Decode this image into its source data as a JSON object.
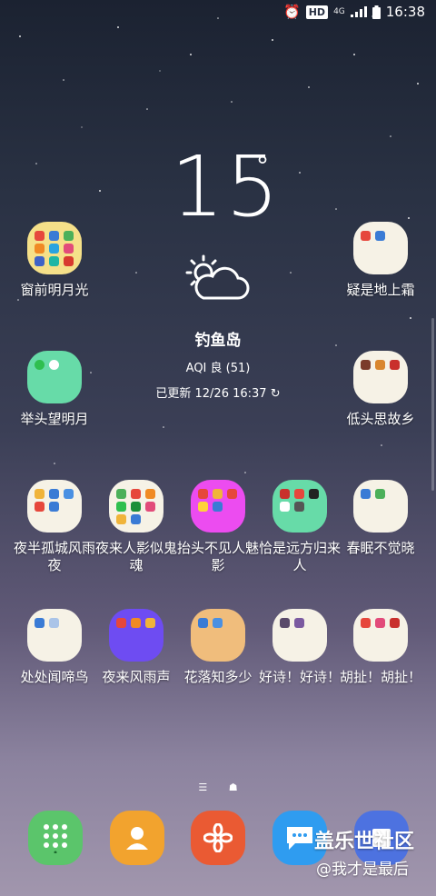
{
  "status_bar": {
    "time": "16:38",
    "hd_badge": "HD",
    "network": "4G"
  },
  "weather": {
    "temperature": "15",
    "degree": "°",
    "city": "钓鱼岛",
    "aqi": "AQI 良 (51)",
    "updated": "已更新 12/26 16:37"
  },
  "folders": [
    {
      "label": "窗前明月光",
      "color": "#f5e089"
    },
    {
      "label": "疑是地上霜",
      "color": "#f6f2e6"
    },
    {
      "label": "举头望明月",
      "color": "#67dba8"
    },
    {
      "label": "低头思故乡",
      "color": "#f6f2e6"
    },
    {
      "label": "夜半孤城风雨夜",
      "color": "#f6f2e6"
    },
    {
      "label": "夜来人影似鬼魂",
      "color": "#f6f2e6"
    },
    {
      "label": "抬头不见人魅影",
      "color": "#ec4cf0"
    },
    {
      "label": "恰是远方归来人",
      "color": "#67dba8"
    },
    {
      "label": "春眠不觉晓",
      "color": "#f6f2e6"
    },
    {
      "label": "处处闻啼鸟",
      "color": "#f6f2e6"
    },
    {
      "label": "夜来风雨声",
      "color": "#6e4cf2"
    },
    {
      "label": "花落知多少",
      "color": "#f0bd7c"
    },
    {
      "label": "好诗！好诗！",
      "color": "#f6f2e6"
    },
    {
      "label": "胡扯！胡扯！",
      "color": "#f6f2e6"
    }
  ],
  "dock": {
    "apps": [
      "phone-app",
      "contacts-app",
      "gallery-app",
      "messages-app",
      "note-app"
    ]
  },
  "watermark": {
    "line1": "盖乐世社区",
    "line2": "@我才是最后"
  }
}
